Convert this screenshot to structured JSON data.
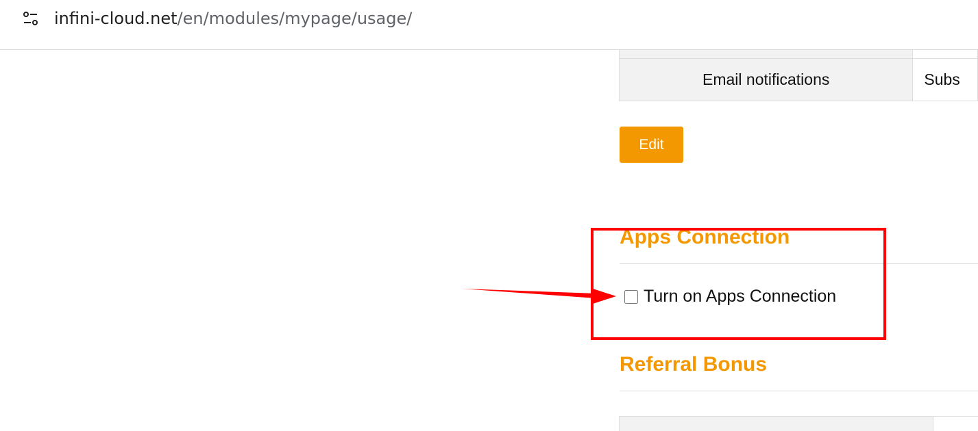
{
  "browser": {
    "url_domain": "infini-cloud.net",
    "url_path": "/en/modules/mypage/usage/"
  },
  "settings_table": {
    "email_label": "Email notifications",
    "email_value": "Subs"
  },
  "edit_button_label": "Edit",
  "apps_connection": {
    "title": "Apps Connection",
    "checkbox_label": "Turn on Apps Connection",
    "checked": false
  },
  "referral_bonus": {
    "title": "Referral Bonus"
  },
  "colors": {
    "accent": "#f39800",
    "annotation": "#ff0000",
    "table_header_bg": "#f2f2f2"
  },
  "icons": {
    "site_info": "tune-icon"
  }
}
